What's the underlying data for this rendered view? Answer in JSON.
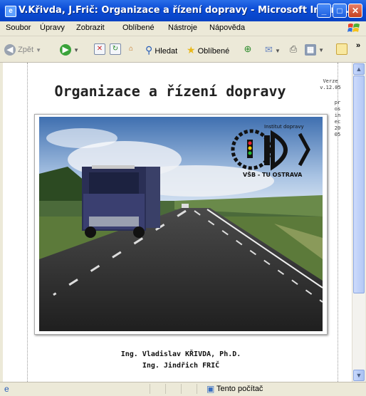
{
  "window": {
    "title": "V.Křivda, J.Frič: Organizace a řízení dopravy - Microsoft Intern...",
    "buttons": {
      "minimize": "_",
      "maximize": "□",
      "close": "✕"
    }
  },
  "menubar": {
    "items": [
      "Soubor",
      "Úpravy",
      "Zobrazit",
      "Oblíbené",
      "Nástroje",
      "Nápověda"
    ]
  },
  "toolbar": {
    "back_label": "Zpět",
    "search_label": "Hledat",
    "favorites_label": "Oblíbené",
    "chevron": "»"
  },
  "page": {
    "title": "Organizace a řízení dopravy",
    "version_label": "Verze",
    "version_value": "v.12.05",
    "date_vertical": "prosinec 2005",
    "logo_top": "Institut dopravy",
    "logo_bottom": "VŠB - TU OSTRAVA",
    "authors": [
      "Ing. Vladislav KŘIVDA, Ph.D.",
      "Ing. Jindřich FRIČ"
    ]
  },
  "statusbar": {
    "zone_text": "Tento počítač"
  },
  "colors": {
    "titlebar": "#0a4bd6",
    "chrome": "#ece9d8",
    "scrollbar_thumb": "#b3c8f5"
  }
}
